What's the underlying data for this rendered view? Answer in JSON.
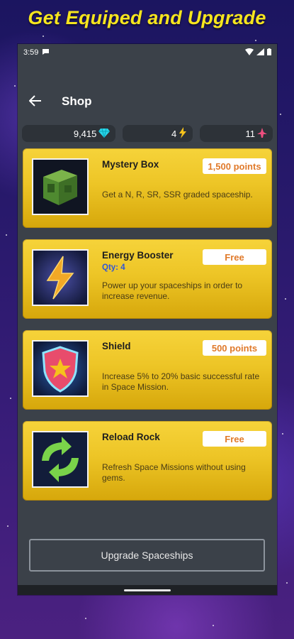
{
  "headline": "Get Equiped and Upgrade",
  "status_bar": {
    "time": "3:59"
  },
  "app_bar": {
    "title": "Shop"
  },
  "stats": {
    "gems": "9,415",
    "energy": "4",
    "spaceships": "11"
  },
  "items": [
    {
      "title": "Mystery Box",
      "qty": "",
      "price": "1,500 points",
      "description": "Get a N, R, SR, SSR graded spaceship."
    },
    {
      "title": "Energy Booster",
      "qty": "Qty: 4",
      "price": "Free",
      "description": "Power up your spaceships in order to increase revenue."
    },
    {
      "title": "Shield",
      "qty": "",
      "price": "500 points",
      "description": "Increase 5% to 20% basic successful rate in Space Mission."
    },
    {
      "title": "Reload Rock",
      "qty": "",
      "price": "Free",
      "description": "Refresh Space Missions without using gems."
    }
  ],
  "upgrade_button": "Upgrade Spaceships",
  "colors": {
    "accent_yellow": "#f6e51e",
    "card_gold": "#edc526",
    "price_orange": "#e07a2a",
    "qty_blue": "#2f56d8"
  }
}
